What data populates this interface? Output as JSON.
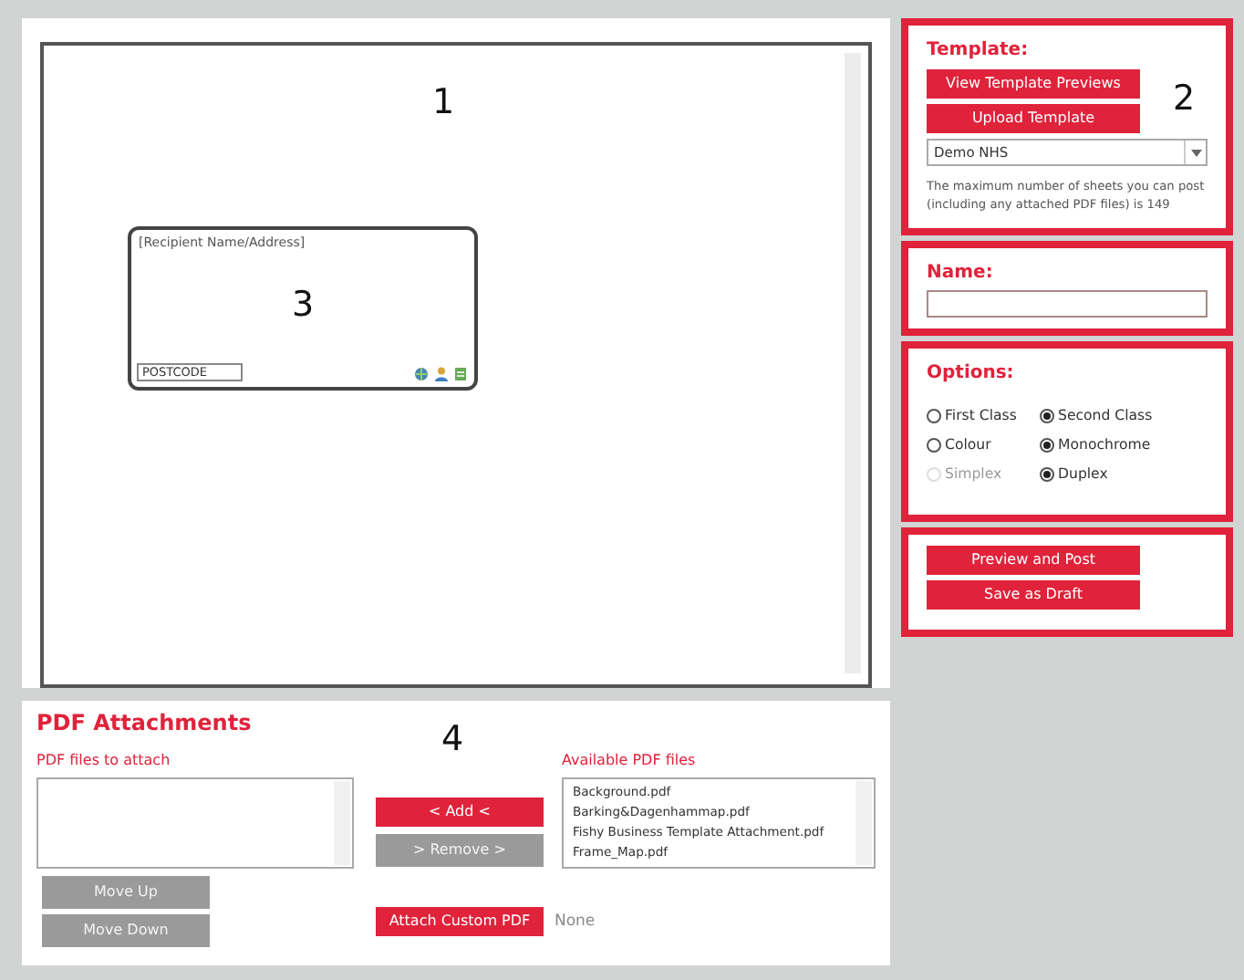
{
  "canvas": {
    "marker": "1",
    "address_box": {
      "placeholder": "[Recipient Name/Address]",
      "marker": "3",
      "postcode": "POSTCODE"
    }
  },
  "template": {
    "heading": "Template:",
    "marker": "2",
    "buttons": [
      {
        "label": "View Template Previews"
      },
      {
        "label": "Upload Template"
      }
    ],
    "select_value": "Demo NHS",
    "note": "The maximum number of sheets you can post (including any attached PDF files) is 149"
  },
  "name": {
    "heading": "Name:"
  },
  "options": {
    "heading": "Options:",
    "rows": [
      [
        {
          "label": "First Class",
          "selected": false,
          "disabled": false
        },
        {
          "label": "Second Class",
          "selected": true,
          "disabled": false
        }
      ],
      [
        {
          "label": "Colour",
          "selected": false,
          "disabled": false
        },
        {
          "label": "Monochrome",
          "selected": true,
          "disabled": false
        }
      ],
      [
        {
          "label": "Simplex",
          "selected": false,
          "disabled": true
        },
        {
          "label": "Duplex",
          "selected": true,
          "disabled": false
        }
      ]
    ]
  },
  "actions": [
    {
      "label": "Preview and Post"
    },
    {
      "label": "Save as Draft"
    }
  ],
  "attachments": {
    "heading": "PDF Attachments",
    "marker": "4",
    "to_attach_label": "PDF files to attach",
    "available_label": "Available PDF files",
    "available_files": [
      "Background.pdf",
      "Barking&Dagenhammap.pdf",
      "Fishy Business Template Attachment.pdf",
      "Frame_Map.pdf"
    ],
    "move_buttons": [
      {
        "label": "Move Up",
        "disabled": true
      },
      {
        "label": "Move Down",
        "disabled": true
      }
    ],
    "transfer_buttons": [
      {
        "label": "< Add <",
        "disabled": false
      },
      {
        "label": "> Remove >",
        "disabled": true
      }
    ],
    "custom_button": {
      "label": "Attach Custom PDF",
      "disabled": false
    },
    "custom_status": "None"
  }
}
